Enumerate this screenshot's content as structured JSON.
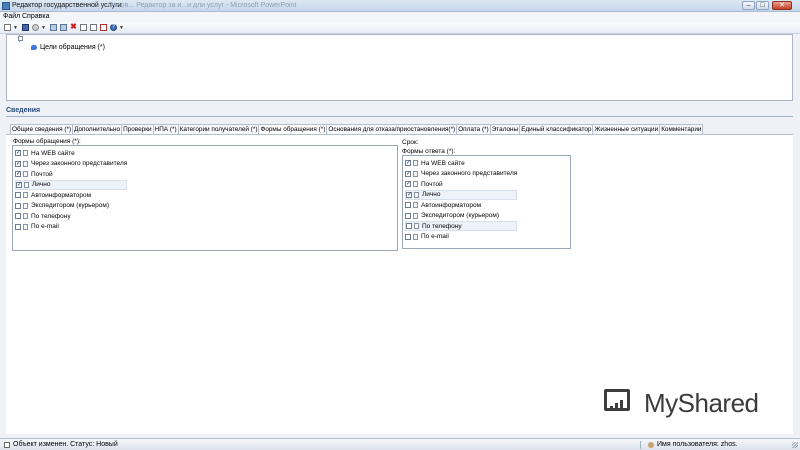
{
  "window": {
    "title": "Редактор государственной услуги",
    "background_title": "Основ... Редактор за и...и дли услуг - Microsoft PowerPoint",
    "buttons": {
      "minimize": "–",
      "maximize": "□",
      "close": "✕"
    }
  },
  "menu": {
    "items": [
      "Файл",
      "Справка"
    ]
  },
  "toolbar": {
    "icons": [
      "new-doc-icon",
      "caret-icon",
      "save-icon",
      "refresh-icon",
      "caret-icon",
      "table-icon",
      "grid-icon",
      "delete-icon",
      "copy-icon",
      "paste-icon",
      "export-icon",
      "help-icon",
      "caret-icon"
    ],
    "help_label": "?",
    "delete_label": "✖",
    "caret": "▼"
  },
  "tree": {
    "items": [
      {
        "label": "Цели обращения (*)",
        "icon": "balloon-icon"
      }
    ]
  },
  "section": {
    "title": "Сведения",
    "tabs": [
      "Общие сведения (*)",
      "Дополнительно",
      "Проверки",
      "НПА (*)",
      "Категории получателей (*)",
      "Формы обращения (*)",
      "Основания для отказа/приостановления(*)",
      "Оплата (*)",
      "Эталоны",
      "Единый классификатор",
      "Жизненные ситуации",
      "Комментарии"
    ],
    "active_tab_index": 5
  },
  "forms_request": {
    "label": "Формы обращения (*):",
    "items": [
      {
        "label": "На WEB сайте",
        "checked": true
      },
      {
        "label": "Через законного представителя",
        "checked": true
      },
      {
        "label": "Почтой",
        "checked": true
      },
      {
        "label": "Лично",
        "checked": true
      },
      {
        "label": "Автоинформатором",
        "checked": false
      },
      {
        "label": "Экспедитором (курьером)",
        "checked": false
      },
      {
        "label": "По телефону",
        "checked": false
      },
      {
        "label": "По e-mail",
        "checked": false
      }
    ],
    "selected_index": 3
  },
  "term": {
    "label": "Срок:"
  },
  "forms_response": {
    "label": "Формы ответа (*):",
    "items": [
      {
        "label": "На WEB сайте",
        "checked": true
      },
      {
        "label": "Через законного представителя",
        "checked": true
      },
      {
        "label": "Почтой",
        "checked": true
      },
      {
        "label": "Лично",
        "checked": true
      },
      {
        "label": "Автоинформатором",
        "checked": false
      },
      {
        "label": "Экспедитором (курьером)",
        "checked": false
      },
      {
        "label": "По телефону",
        "checked": false
      },
      {
        "label": "По e-mail",
        "checked": false
      }
    ],
    "selected_indices": [
      3,
      6
    ]
  },
  "check_mark": "✓",
  "watermark": {
    "text": "MyShared",
    "icon": "chart-presentation-icon"
  },
  "status": {
    "text": "Объект изменен. Статус: Новый",
    "user": "Имя пользователя: zhos."
  }
}
